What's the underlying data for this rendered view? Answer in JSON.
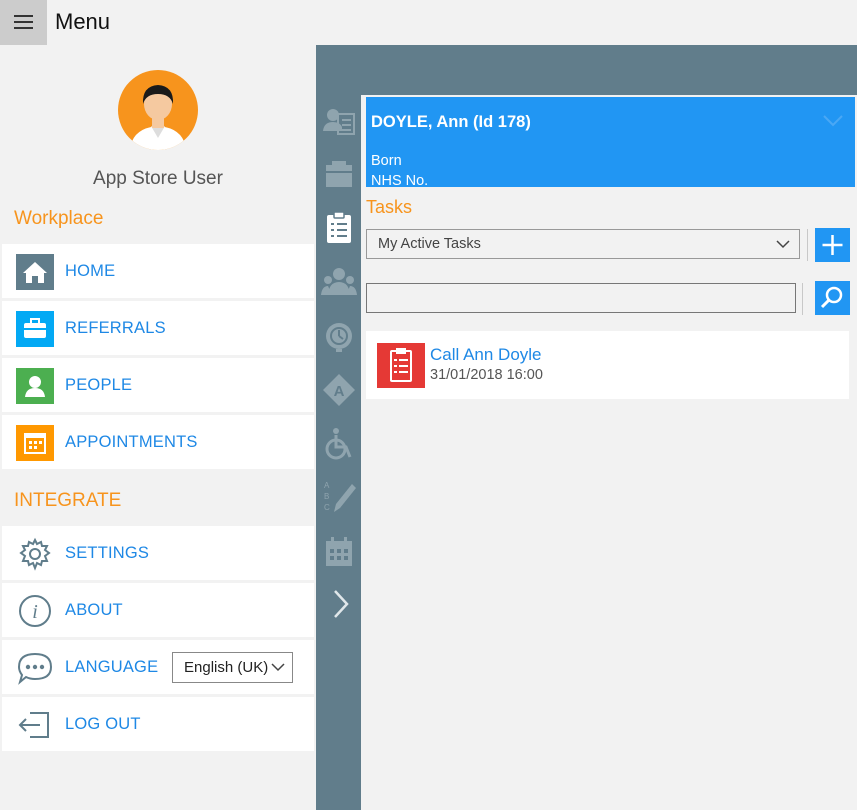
{
  "header": {
    "title": "Menu"
  },
  "user": {
    "name": "App Store User"
  },
  "sections": {
    "workplace": "Workplace",
    "integrate": "INTEGRATE"
  },
  "menu": {
    "home": "HOME",
    "referrals": "REFERRALS",
    "people": "PEOPLE",
    "appointments": "APPOINTMENTS",
    "settings": "SETTINGS",
    "about": "ABOUT",
    "language": "LANGUAGE",
    "logout": "LOG OUT"
  },
  "language_select": {
    "value": "English (UK)"
  },
  "patient": {
    "name": "DOYLE, Ann (Id 178)",
    "born_label": "Born",
    "nhs_label": "NHS No."
  },
  "tasks": {
    "heading": "Tasks",
    "filter": "My Active Tasks",
    "search_value": "",
    "items": [
      {
        "title": "Call Ann Doyle",
        "date": "31/01/2018 16:00"
      }
    ]
  },
  "colors": {
    "accent_orange": "#f7941d",
    "blue": "#2196f3",
    "link_blue": "#1e88e5",
    "slate": "#617d8b",
    "home_icon": "#607d8b",
    "referrals_icon": "#03a9f4",
    "people_icon": "#4caf50",
    "appointments_icon": "#ff9800",
    "task_icon": "#e53935"
  },
  "icons": {
    "side_nav": [
      "person-details-icon",
      "folder-icon",
      "clipboard-icon",
      "group-icon",
      "alarm-icon",
      "alert-icon",
      "wheelchair-icon",
      "abc-pen-icon",
      "calendar-icon",
      "chevron-right-icon"
    ]
  }
}
